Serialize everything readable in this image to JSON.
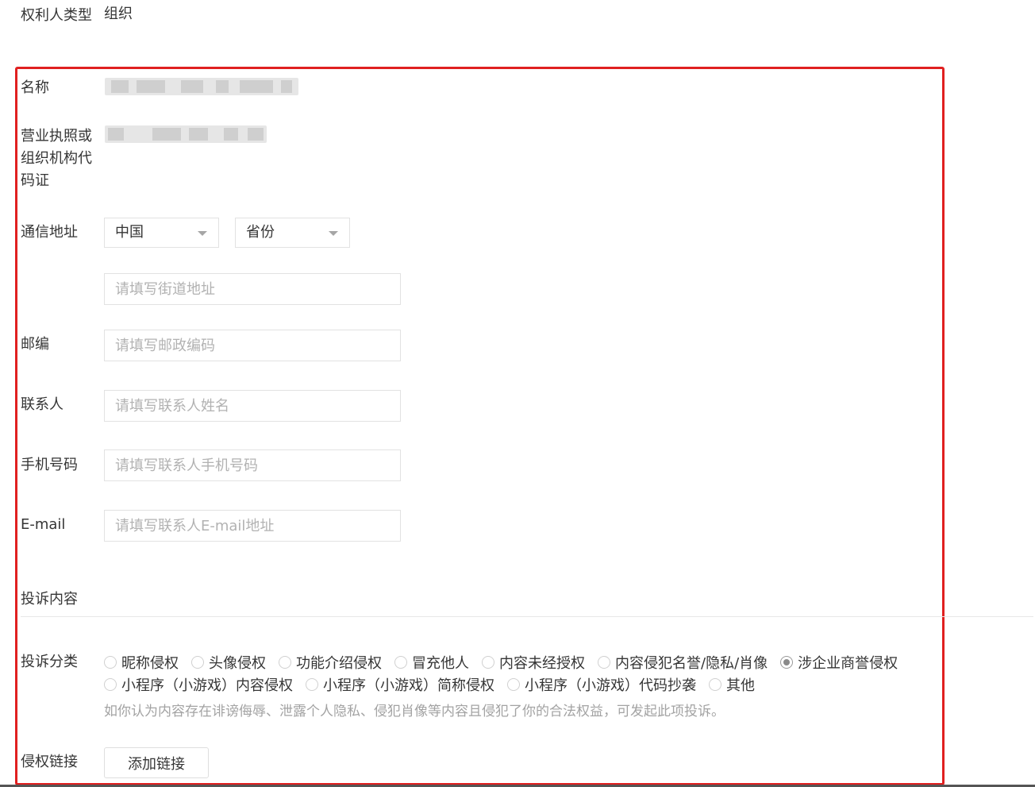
{
  "rights_holder": {
    "label": "权利人类型",
    "value": "组织"
  },
  "name": {
    "label": "名称"
  },
  "license": {
    "label_lines": [
      "营业执照或",
      "组织机构代",
      "码证"
    ]
  },
  "address": {
    "label": "通信地址",
    "country": "中国",
    "province": "省份",
    "street_placeholder": "请填写街道地址"
  },
  "postal": {
    "label": "邮编",
    "placeholder": "请填写邮政编码"
  },
  "contact": {
    "label": "联系人",
    "placeholder": "请填写联系人姓名"
  },
  "phone": {
    "label": "手机号码",
    "placeholder": "请填写联系人手机号码"
  },
  "email": {
    "label": "E-mail",
    "placeholder": "请填写联系人E-mail地址"
  },
  "complaint": {
    "section_title": "投诉内容",
    "category_label": "投诉分类",
    "categories_row1": [
      "昵称侵权",
      "头像侵权",
      "功能介绍侵权",
      "冒充他人",
      "内容未经授权",
      "内容侵犯名誉/隐私/肖像",
      "涉企业商誉侵权"
    ],
    "categories_row2": [
      "小程序（小游戏）内容侵权",
      "小程序（小游戏）简称侵权",
      "小程序（小游戏）代码抄袭",
      "其他"
    ],
    "selected": "涉企业商誉侵权",
    "hint": "如你认为内容存在诽谤侮辱、泄露个人隐私、侵犯肖像等内容且侵犯了你的合法权益，可发起此项投诉。",
    "link_label": "侵权链接",
    "add_link_button": "添加链接"
  }
}
